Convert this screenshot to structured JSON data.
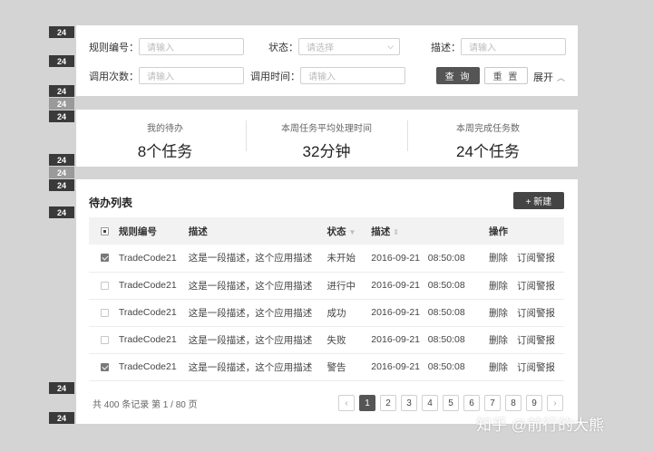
{
  "spacers": [
    "24",
    "24",
    "24",
    "24",
    "24",
    "24",
    "24",
    "24",
    "24",
    "24",
    "24",
    "24"
  ],
  "filters": {
    "rule_code": {
      "label": "规则编号：",
      "placeholder": "请输入"
    },
    "status": {
      "label": "状态：",
      "placeholder": "请选择"
    },
    "description": {
      "label": "描述：",
      "placeholder": "请输入"
    },
    "call_count": {
      "label": "调用次数：",
      "placeholder": "请输入"
    },
    "call_time": {
      "label": "调用时间：",
      "placeholder": "请输入"
    },
    "query_label": "查 询",
    "reset_label": "重 置",
    "expand_label": "展开"
  },
  "stats": [
    {
      "title": "我的待办",
      "value": "8个任务"
    },
    {
      "title": "本周任务平均处理时间",
      "value": "32分钟"
    },
    {
      "title": "本周完成任务数",
      "value": "24个任务"
    }
  ],
  "list": {
    "title": "待办列表",
    "new_label": "+ 新建",
    "columns": [
      "规则编号",
      "描述",
      "状态",
      "描述",
      "操作"
    ],
    "rows": [
      {
        "code": "TradeCode21",
        "desc": "这是一段描述，这个应用描述",
        "status": "未开始",
        "date": "2016-09-21",
        "time": "08:50:08",
        "op1": "删除",
        "op2": "订阅警报",
        "checked": true
      },
      {
        "code": "TradeCode21",
        "desc": "这是一段描述，这个应用描述",
        "status": "进行中",
        "date": "2016-09-21",
        "time": "08:50:08",
        "op1": "删除",
        "op2": "订阅警报",
        "checked": false
      },
      {
        "code": "TradeCode21",
        "desc": "这是一段描述，这个应用描述",
        "status": "成功",
        "date": "2016-09-21",
        "time": "08:50:08",
        "op1": "删除",
        "op2": "订阅警报",
        "checked": false
      },
      {
        "code": "TradeCode21",
        "desc": "这是一段描述，这个应用描述",
        "status": "失败",
        "date": "2016-09-21",
        "time": "08:50:08",
        "op1": "删除",
        "op2": "订阅警报",
        "checked": false
      },
      {
        "code": "TradeCode21",
        "desc": "这是一段描述，这个应用描述",
        "status": "警告",
        "date": "2016-09-21",
        "time": "08:50:08",
        "op1": "删除",
        "op2": "订阅警报",
        "checked": true
      }
    ],
    "total": "共 400 条记录 第 1 / 80 页",
    "pages": [
      "1",
      "2",
      "3",
      "4",
      "5",
      "6",
      "7",
      "8",
      "9"
    ],
    "prev_icon": "‹",
    "next_icon": "›"
  },
  "watermark": "知乎 @前行的大熊"
}
